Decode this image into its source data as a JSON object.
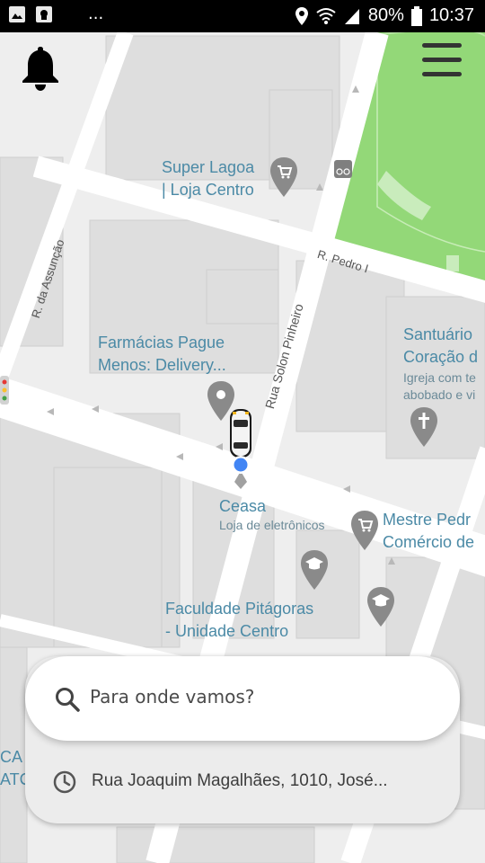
{
  "status_bar": {
    "notification_icons": [
      "image-icon",
      "android-icon"
    ],
    "more": "...",
    "battery": "80%",
    "time": "10:37"
  },
  "map": {
    "pois": {
      "super_lagoa_1": "Super Lagoa",
      "super_lagoa_2": "| Loja Centro",
      "farmacias_1": "Farmácias Pague",
      "farmacias_2": "Menos: Delivery...",
      "santuario_1": "Santuário",
      "santuario_2": "Coração d",
      "santuario_sub_1": "Igreja com te",
      "santuario_sub_2": "abobado e vi",
      "ceasa": "Ceasa",
      "ceasa_sub": "Loja de eletrônicos",
      "mestre_1": "Mestre Pedr",
      "mestre_2": "Comércio de",
      "faculdade_1": "Faculdade Pitágoras",
      "faculdade_2": "- Unidade Centro",
      "left_edge_1": "CA",
      "left_edge_2": "ATC"
    },
    "streets": {
      "pedro": "R. Pedro I",
      "assuncao": "R. da Assunção",
      "solon": "Rua Solon Pinheiro"
    }
  },
  "search": {
    "placeholder": "Para onde vamos?",
    "recent_address": "Rua Joaquim Magalhães, 1010, José..."
  },
  "colors": {
    "map_bg": "#eeeeee",
    "park": "#93d878",
    "road": "#ffffff",
    "block": "#dedede",
    "poi_label": "#4b8aa6",
    "location_dot": "#4285f4"
  }
}
